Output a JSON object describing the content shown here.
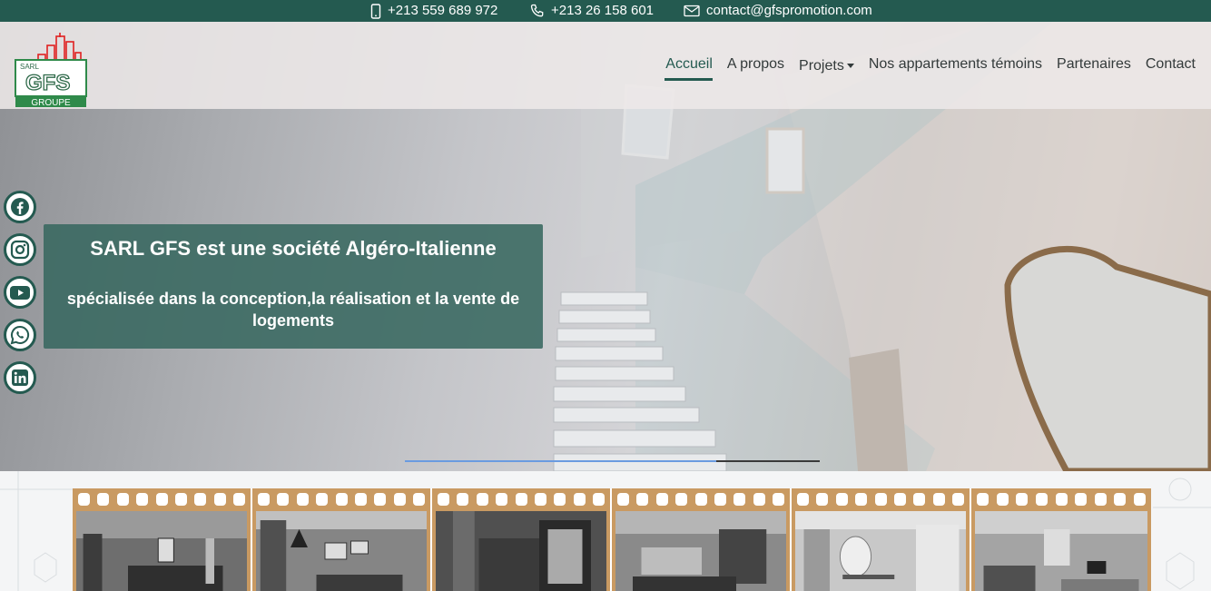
{
  "contact_bar": {
    "mobile": "+213 559 689 972",
    "phone": "+213 26 158 601",
    "email": "contact@gfspromotion.com",
    "icons": [
      "mobile-phone-icon",
      "phone-icon",
      "envelope-icon"
    ]
  },
  "logo": {
    "top_text": "SARL",
    "main_text": "GFS",
    "bottom_text": "GROUPE"
  },
  "nav": {
    "items": [
      {
        "label": "Accueil",
        "active": true
      },
      {
        "label": "A propos"
      },
      {
        "label": "Projets",
        "dropdown": true
      },
      {
        "label": "Nos appartements témoins"
      },
      {
        "label": "Partenaires"
      },
      {
        "label": "Contact"
      }
    ]
  },
  "social": [
    "facebook-icon",
    "instagram-icon",
    "youtube-icon",
    "whatsapp-icon",
    "linkedin-icon"
  ],
  "hero": {
    "title": "SARL GFS est une société Algéro-Italienne",
    "subtitle": "spécialisée dans la conception,la réalisation et la vente de logements",
    "slider_progress": 0.75
  },
  "colors": {
    "brand": "#245a50",
    "caption_bg": "#386860",
    "film_frame": "#c99a62",
    "logo_red": "#e02020"
  },
  "gallery": {
    "photos": [
      "bedroom",
      "living-room",
      "kitchen",
      "living-dining",
      "hallway",
      "lounge"
    ]
  }
}
